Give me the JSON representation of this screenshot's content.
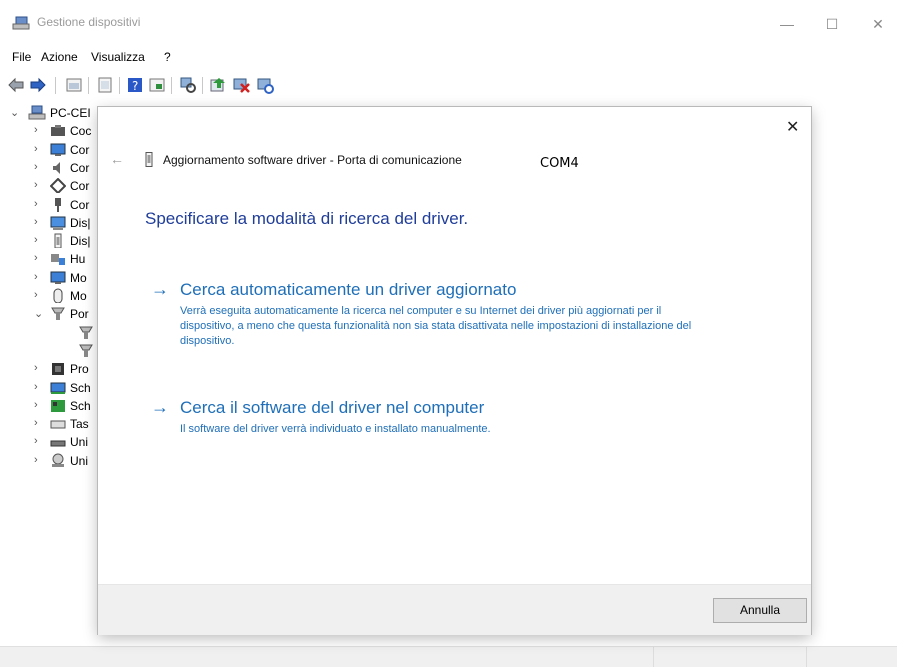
{
  "window": {
    "title": "Gestione dispositivi",
    "minimize_glyph": "—",
    "maximize_glyph": "☐",
    "close_glyph": "✕"
  },
  "menu": [
    "File",
    "Azione",
    "Visualizza",
    "?"
  ],
  "tree": {
    "root_label": "PC-CEI",
    "items": [
      {
        "label": "Coc",
        "icon": "camera-icon"
      },
      {
        "label": "Cor",
        "icon": "monitor-icon"
      },
      {
        "label": "Cor",
        "icon": "speaker-icon"
      },
      {
        "label": "Cor",
        "icon": "network-icon"
      },
      {
        "label": "Cor",
        "icon": "plug-icon"
      },
      {
        "label": "Dis|",
        "icon": "display-icon"
      },
      {
        "label": "Dis|",
        "icon": "usb-stick-icon"
      },
      {
        "label": "Hu",
        "icon": "hid-icon"
      },
      {
        "label": "Mo",
        "icon": "monitor-icon"
      },
      {
        "label": "Mo",
        "icon": "mouse-icon"
      },
      {
        "label": "Por",
        "icon": "port-icon"
      },
      {
        "label": "",
        "icon": "port-icon"
      },
      {
        "label": "",
        "icon": "port-icon"
      },
      {
        "label": "Pro",
        "icon": "processor-icon"
      },
      {
        "label": "Sch",
        "icon": "adapter-icon"
      },
      {
        "label": "Sch",
        "icon": "board-icon"
      },
      {
        "label": "Tas",
        "icon": "keyboard-icon"
      },
      {
        "label": "Uni",
        "icon": "drive-icon"
      },
      {
        "label": "Uni",
        "icon": "storage-icon"
      }
    ]
  },
  "dialog": {
    "close_glyph": "✕",
    "back_glyph": "←",
    "header": "Aggiornamento software driver - Porta di comunicazione",
    "com_label": "COM4",
    "question": "Specificare la modalità di ricerca del driver.",
    "option1": {
      "arrow": "→",
      "title": "Cerca automaticamente un driver aggiornato",
      "desc": "Verrà eseguita automaticamente la ricerca nel computer e su Internet dei driver più aggiornati per il dispositivo, a meno che questa funzionalità non sia stata disattivata nelle impostazioni di installazione del dispositivo."
    },
    "option2": {
      "arrow": "→",
      "title": "Cerca il software del driver nel computer",
      "desc": "Il software del driver verrà individuato e installato manualmente."
    },
    "cancel_label": "Annulla"
  },
  "colors": {
    "link_blue": "#1f6fb8",
    "heading_blue": "#1f3d99"
  }
}
